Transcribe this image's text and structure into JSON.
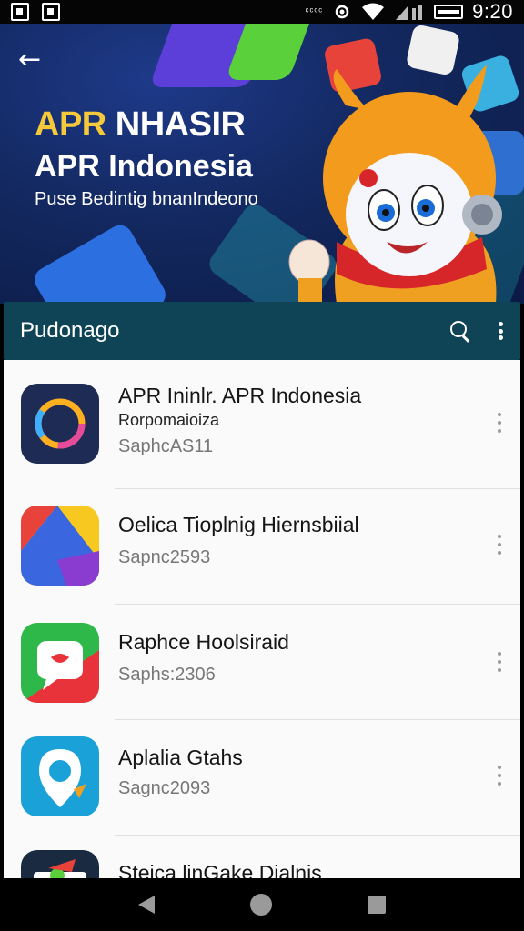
{
  "status_bar": {
    "time": "9:20",
    "small_text": "ᶜᶜᶜᶜ"
  },
  "hero": {
    "title_line1_accent": "APR",
    "title_line1_rest": " NHASIR",
    "title_line2": "APR Indonesia",
    "subtitle": "Puse Bedintig bnanIndeono",
    "accent_color": "#f5c93a"
  },
  "toolbar": {
    "title": "Pudonago",
    "search_icon": "search-icon",
    "more_icon": "more-vert-icon"
  },
  "apps": [
    {
      "title": "APR Ininlr. APR Indonesia",
      "subtitle": "Rorpomaioiza",
      "meta": "SaphcAS11",
      "icon": "camera-chat-app-icon"
    },
    {
      "title": "Oelica Tioplnig Hiernsbiial",
      "subtitle": "",
      "meta": "Sapnc2593",
      "icon": "colorful-tile-app-icon"
    },
    {
      "title": "Raphce Hoolsiraid",
      "subtitle": "",
      "meta": "Saphs:2306",
      "icon": "chat-bubble-app-icon"
    },
    {
      "title": "Aplalia Gtahs",
      "subtitle": "",
      "meta": "Sagnc2093",
      "icon": "location-pin-app-icon"
    },
    {
      "title": "Steica linGake Dialnis",
      "subtitle": "",
      "meta": "",
      "icon": "game-app-icon"
    }
  ]
}
